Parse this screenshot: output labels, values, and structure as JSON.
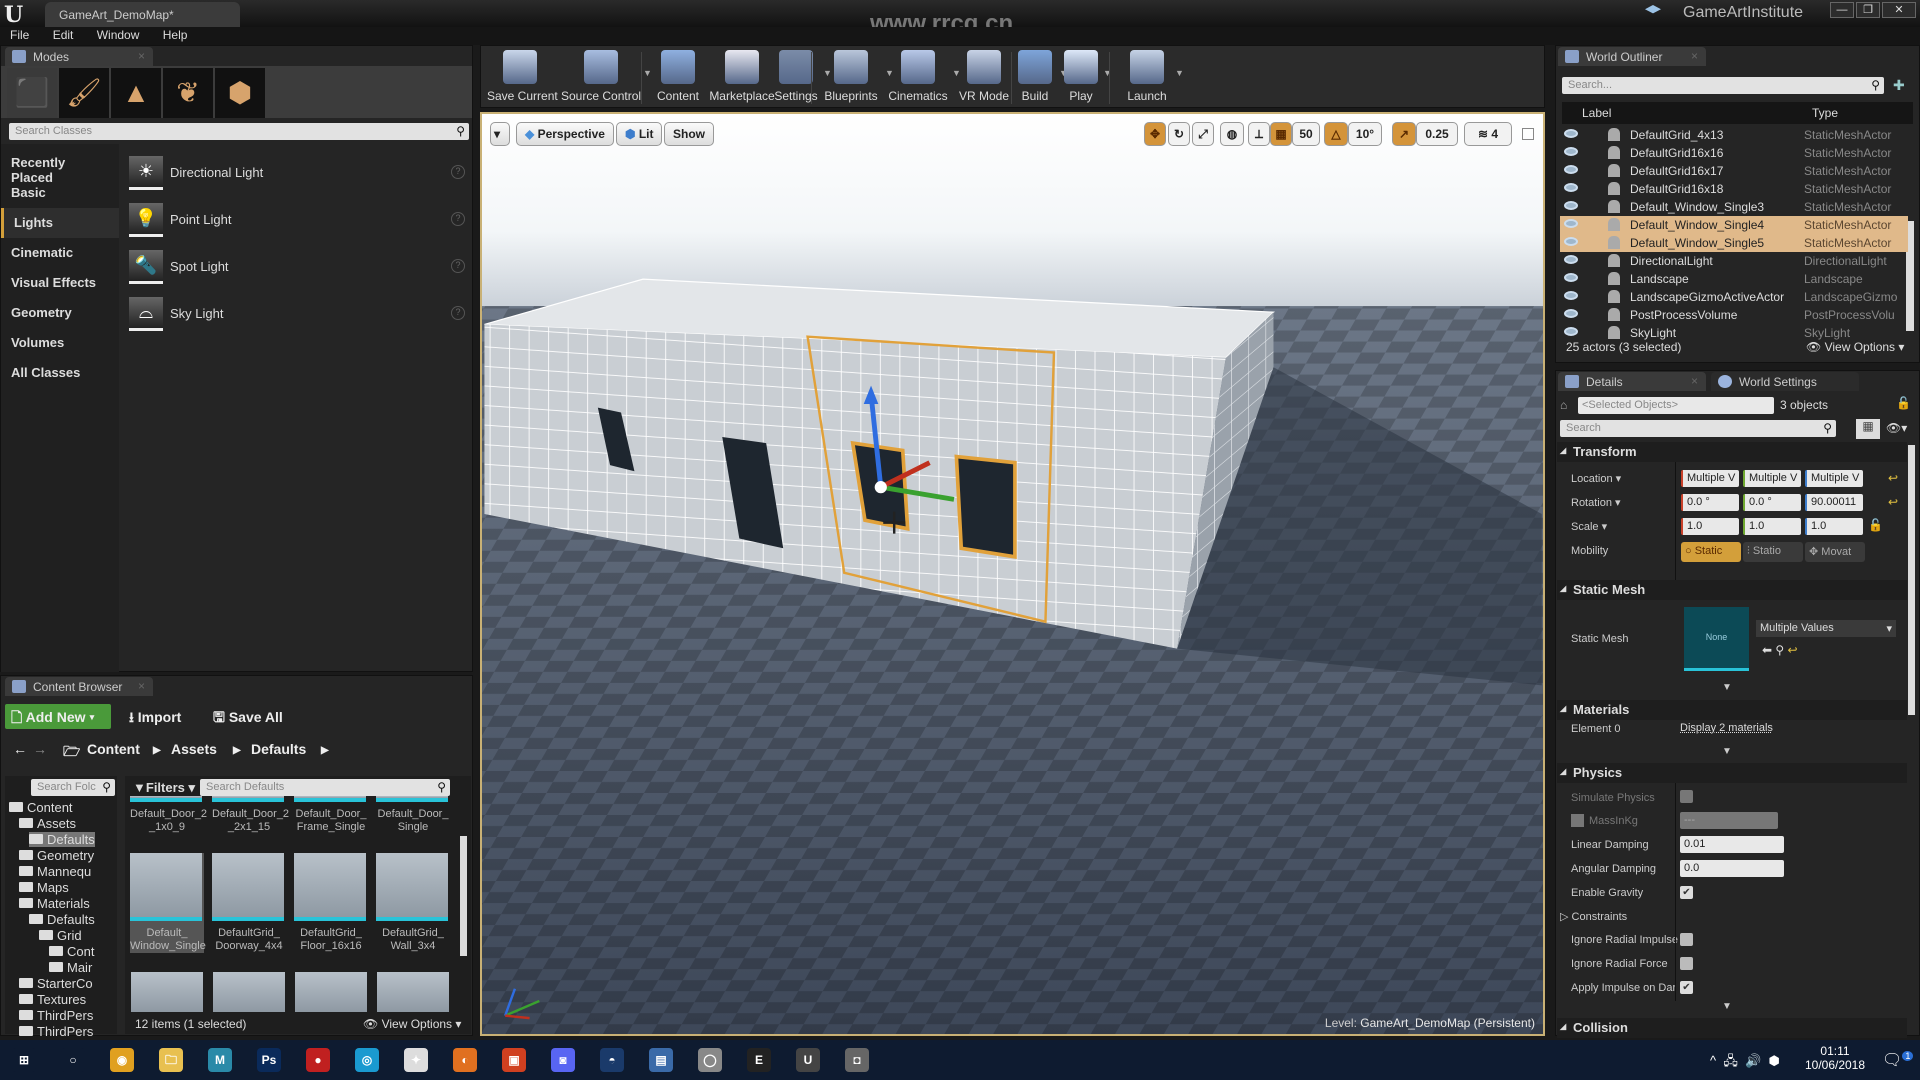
{
  "window": {
    "title": "GameArt_DemoMap*",
    "brand": "GameArtInstitute",
    "watermark": "www.rrcg.cn",
    "controls": [
      "—",
      "❐",
      "✕"
    ]
  },
  "menu": [
    "File",
    "Edit",
    "Window",
    "Help"
  ],
  "modes": {
    "tab": "Modes",
    "mode_icons": [
      "place-mode",
      "paint-mode",
      "landscape-mode",
      "foliage-mode",
      "geometry-mode"
    ],
    "search_placeholder": "Search Classes",
    "categories": [
      "Recently Placed",
      "Basic",
      "Lights",
      "Cinematic",
      "Visual Effects",
      "Geometry",
      "Volumes",
      "All Classes"
    ],
    "selected_category": "Lights",
    "items": [
      "Directional Light",
      "Point Light",
      "Spot Light",
      "Sky Light"
    ]
  },
  "toolbar": {
    "buttons": [
      "Save Current",
      "Source Control",
      "Content",
      "Marketplace",
      "Settings",
      "Blueprints",
      "Cinematics",
      "VR Mode",
      "Build",
      "Play",
      "Launch"
    ]
  },
  "viewport": {
    "perspective": "Perspective",
    "lit": "Lit",
    "show": "Show",
    "grid_snap": "50",
    "rotation_snap": "10°",
    "scale_snap": "0.25",
    "camera_speed": "4",
    "level_label": "Level:",
    "level_name": "GameArt_DemoMap (Persistent)",
    "accent": "#d4943a"
  },
  "outliner": {
    "tab": "World Outliner",
    "search_placeholder": "Search...",
    "col_label": "Label",
    "col_type": "Type",
    "rows": [
      {
        "label": "DefaultGrid_4x13",
        "type": "StaticMeshActor",
        "selected": false
      },
      {
        "label": "DefaultGrid16x16",
        "type": "StaticMeshActor",
        "selected": false
      },
      {
        "label": "DefaultGrid16x17",
        "type": "StaticMeshActor",
        "selected": false
      },
      {
        "label": "DefaultGrid16x18",
        "type": "StaticMeshActor",
        "selected": false
      },
      {
        "label": "Default_Window_Single3",
        "type": "StaticMeshActor",
        "selected": false
      },
      {
        "label": "Default_Window_Single4",
        "type": "StaticMeshActor",
        "selected": true
      },
      {
        "label": "Default_Window_Single5",
        "type": "StaticMeshActor",
        "selected": true
      },
      {
        "label": "DirectionalLight",
        "type": "DirectionalLight",
        "selected": false
      },
      {
        "label": "Landscape",
        "type": "Landscape",
        "selected": false
      },
      {
        "label": "LandscapeGizmoActiveActor",
        "type": "LandscapeGizmo",
        "selected": false
      },
      {
        "label": "PostProcessVolume",
        "type": "PostProcessVolu",
        "selected": false
      },
      {
        "label": "SkyLight",
        "type": "SkyLight",
        "selected": false
      }
    ],
    "status": "25 actors (3 selected)",
    "view_options": "View Options"
  },
  "details": {
    "tab": "Details",
    "tab2": "World Settings",
    "selected_placeholder": "<Selected Objects>",
    "object_count": "3 objects",
    "search_placeholder": "Search",
    "transform": {
      "title": "Transform",
      "location_label": "Location",
      "location": [
        "Multiple V",
        "Multiple V",
        "Multiple V"
      ],
      "rotation_label": "Rotation",
      "rotation": [
        "0.0 °",
        "0.0 °",
        "90.00011"
      ],
      "scale_label": "Scale",
      "scale": [
        "1.0",
        "1.0",
        "1.0"
      ],
      "mobility_label": "Mobility",
      "mobility": [
        "Static",
        "Statio",
        "Movat"
      ],
      "mobility_selected": "Static"
    },
    "static_mesh": {
      "title": "Static Mesh",
      "label": "Static Mesh",
      "thumb": "None",
      "value": "Multiple Values"
    },
    "materials": {
      "title": "Materials",
      "element_label": "Element 0",
      "element_value": "Display 2 materials"
    },
    "physics": {
      "title": "Physics",
      "simulate": "Simulate Physics",
      "mass": "MassInKg",
      "mass_value": "---",
      "linear": "Linear Damping",
      "linear_value": "0.01",
      "angular": "Angular Damping",
      "angular_value": "0.0",
      "gravity": "Enable Gravity",
      "gravity_checked": true,
      "constraints": "Constraints",
      "ignore_impulse": "Ignore Radial Impulse",
      "ignore_force": "Ignore Radial Force",
      "apply_impulse": "Apply Impulse on Dar",
      "apply_impulse_checked": true
    },
    "collision": {
      "title": "Collision"
    }
  },
  "content_browser": {
    "tab": "Content Browser",
    "add_new": "Add New",
    "import": "Import",
    "save_all": "Save All",
    "breadcrumb": [
      "Content",
      "Assets",
      "Defaults"
    ],
    "folder_search": "Search Folc",
    "filters": "Filters",
    "search_placeholder": "Search Defaults",
    "tree": [
      {
        "label": "Content",
        "depth": 0
      },
      {
        "label": "Assets",
        "depth": 1
      },
      {
        "label": "Defaults",
        "depth": 2,
        "selected": true
      },
      {
        "label": "Geometry",
        "depth": 1
      },
      {
        "label": "Mannequ",
        "depth": 1
      },
      {
        "label": "Maps",
        "depth": 1
      },
      {
        "label": "Materials",
        "depth": 1
      },
      {
        "label": "Defaults",
        "depth": 2
      },
      {
        "label": "Grid",
        "depth": 3
      },
      {
        "label": "Cont",
        "depth": 4
      },
      {
        "label": "Mair",
        "depth": 4
      },
      {
        "label": "StarterCo",
        "depth": 1
      },
      {
        "label": "Textures",
        "depth": 1
      },
      {
        "label": "ThirdPers",
        "depth": 1
      },
      {
        "label": "ThirdPers",
        "depth": 1
      }
    ],
    "assets_row1": [
      "Default_Door_2 _1x0_9",
      "Default_Door_2 _2x1_15",
      "Default_Door_ Frame_Single",
      "Default_Door_ Single"
    ],
    "assets_row2": [
      "Default_ Window_Single",
      "DefaultGrid_ Doorway_4x4",
      "DefaultGrid_ Floor_16x16",
      "DefaultGrid_ Wall_3x4"
    ],
    "status": "12 items (1 selected)",
    "view_options": "View Options"
  },
  "taskbar": {
    "apps": [
      "windows-start",
      "search",
      "chrome",
      "file-explorer",
      "m-app",
      "photoshop",
      "record",
      "steam-like",
      "3dsmax",
      "blender",
      "app",
      "discord",
      "steam",
      "app2",
      "app3",
      "unreal-launcher",
      "unreal-engine",
      "app4"
    ],
    "time": "01:11",
    "date": "10/06/2018",
    "notifications": "1"
  }
}
